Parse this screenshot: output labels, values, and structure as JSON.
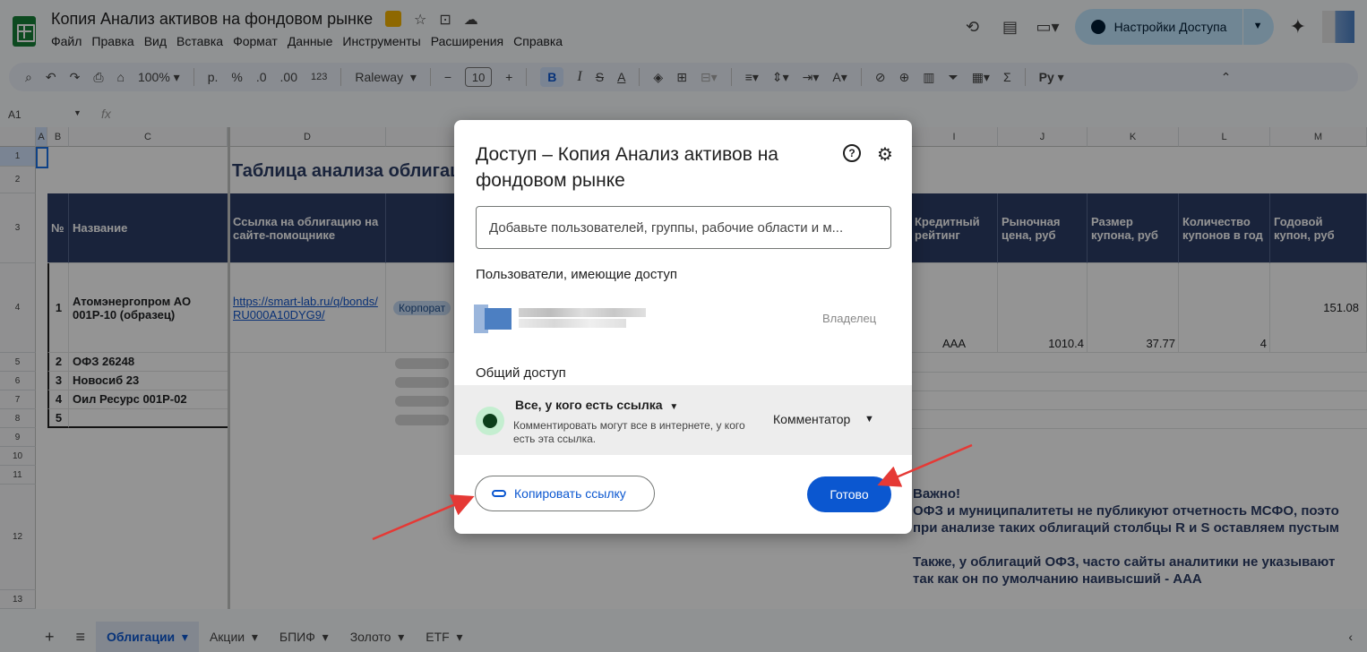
{
  "header": {
    "title": "Копия Анализ активов на фондовом рынке",
    "menu": [
      "Файл",
      "Правка",
      "Вид",
      "Вставка",
      "Формат",
      "Данные",
      "Инструменты",
      "Расширения",
      "Справка"
    ],
    "share_label": "Настройки Доступа"
  },
  "toolbar": {
    "zoom": "100%",
    "currency": "р.",
    "percent": "%",
    "dec_minus": ".0",
    "dec_plus": ".00",
    "number_fmt": "123",
    "font": "Raleway",
    "font_size": "10",
    "bold": "B",
    "italic": "I",
    "strike": "S",
    "text_color": "A",
    "sigma": "Σ",
    "input_tools": "Ру"
  },
  "formula_bar": {
    "cell_ref": "A1",
    "fx": "fx"
  },
  "grid": {
    "columns": [
      "A",
      "B",
      "C",
      "D",
      "I",
      "J",
      "K",
      "L",
      "M"
    ],
    "rows": [
      "1",
      "2",
      "3",
      "4",
      "5",
      "6",
      "7",
      "8",
      "9",
      "10",
      "11",
      "12",
      "13"
    ],
    "sheet_title": "Таблица анализа облигаций",
    "headers": {
      "num": "№",
      "name": "Название",
      "link": "Ссылка на облигацию на сайте-помощнике",
      "rating": "Кредитный рейтинг",
      "price": "Рыночная цена, руб",
      "coupon": "Размер купона, руб",
      "coupons_count": "Количество купонов в год",
      "annual": "Годовой купон, руб"
    },
    "rows_data": [
      {
        "num": "1",
        "name": "Атомэнергопром АО 001Р-10 (образец)",
        "link": "https://smart-lab.ru/q/bonds/RU000A10DYG9/",
        "type": "Корпорат",
        "rating": "AAA",
        "price": "1010.4",
        "coupon": "37.77",
        "count": "4",
        "annual": "151.08"
      },
      {
        "num": "2",
        "name": "ОФЗ 26248"
      },
      {
        "num": "3",
        "name": "Новосиб 23"
      },
      {
        "num": "4",
        "name": "Оил Ресурс 001Р-02"
      },
      {
        "num": "5",
        "name": ""
      }
    ],
    "note_lines": [
      "Важно!",
      "ОФЗ и муниципалитеты не публикуют отчетность МСФО, поэто",
      "при анализе таких облигаций столбцы R и S оставляем пустым",
      "",
      "Также, у облигаций ОФЗ, часто сайты аналитики не указывают",
      "так как он по умолчанию наивысший - AAA"
    ]
  },
  "tabs": {
    "add": "+",
    "list": "≡",
    "items": [
      "Облигации",
      "Акции",
      "БПИФ",
      "Золото",
      "ETF"
    ],
    "active": "Облигации"
  },
  "dialog": {
    "title": "Доступ – Копия Анализ активов на фондовом рынке",
    "input_placeholder": "Добавьте пользователей, группы, рабочие области и м...",
    "people_heading": "Пользователи, имеющие доступ",
    "owner_role": "Владелец",
    "general_heading": "Общий доступ",
    "general_access": "Все, у кого есть ссылка",
    "general_desc": "Комментировать могут все в интернете, у кого есть эта ссылка.",
    "general_role": "Комментатор",
    "copy_link": "Копировать ссылку",
    "done": "Готово"
  },
  "colors": {
    "header_fill": "#2c3d66",
    "accent": "#0b57d0",
    "share_btn": "#c2e7ff",
    "arrow": "#e53935"
  }
}
